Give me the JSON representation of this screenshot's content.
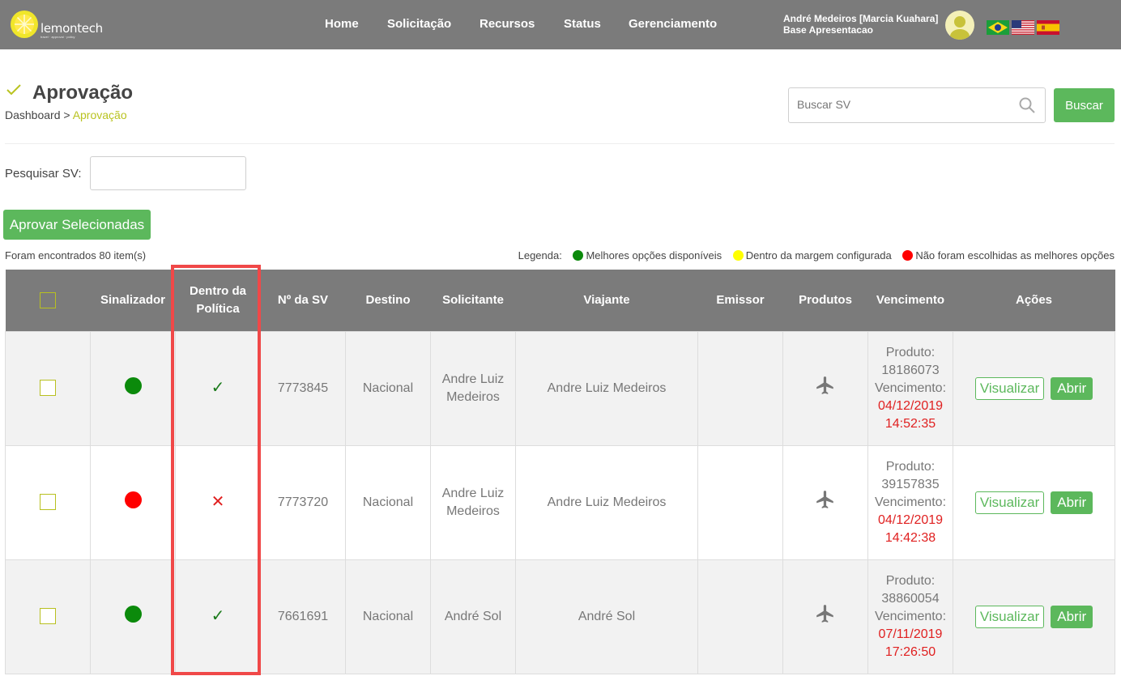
{
  "header": {
    "logo_text": "lemontech",
    "logo_tagline": "travel · approval · policy",
    "nav": [
      "Home",
      "Solicitação",
      "Recursos",
      "Status",
      "Gerenciamento"
    ],
    "user_line1": "André Medeiros [Marcia Kuahara]",
    "user_line2": "Base Apresentacao",
    "flags": [
      "flag-brazil",
      "flag-usa",
      "flag-spain"
    ]
  },
  "page": {
    "title": "Aprovação",
    "breadcrumb_root": "Dashboard",
    "breadcrumb_sep": " > ",
    "breadcrumb_current": "Aprovação",
    "search_placeholder": "Buscar SV",
    "search_button": "Buscar",
    "filter_label": "Pesquisar SV:",
    "approve_button": "Aprovar Selecionadas",
    "found_text": "Foram encontrados 80 item(s)",
    "legend_label": "Legenda:",
    "legend": [
      {
        "label": "Melhores opções disponíveis",
        "color": "#0b8a0b"
      },
      {
        "label": "Dentro da margem configurada",
        "color": "#ffff00"
      },
      {
        "label": "Não foram escolhidas as melhores opções",
        "color": "#ff0000"
      }
    ]
  },
  "table": {
    "columns": [
      "Sinalizador",
      "Dentro da Política",
      "Nº da SV",
      "Destino",
      "Solicitante",
      "Viajante",
      "Emissor",
      "Produtos",
      "Vencimento",
      "Ações"
    ],
    "colors": {
      "green": "#0b8a0b",
      "red": "#ff0000",
      "check": "#1a7a1a",
      "cross": "#e02020"
    },
    "view_label": "Visualizar",
    "open_label": "Abrir",
    "produto_label": "Produto:",
    "vencimento_label": "Vencimento:",
    "rows": [
      {
        "signal": "green",
        "policy": "✓",
        "sv": "7773845",
        "destino": "Nacional",
        "solicitante": "Andre Luiz Medeiros",
        "viajante": "Andre Luiz Medeiros",
        "emissor": "",
        "produto_icon": "airplane-icon",
        "produto_num": "18186073",
        "venc_date": "04/12/2019",
        "venc_time": "14:52:35"
      },
      {
        "signal": "red",
        "policy": "✕",
        "sv": "7773720",
        "destino": "Nacional",
        "solicitante": "Andre Luiz Medeiros",
        "viajante": "Andre Luiz Medeiros",
        "emissor": "",
        "produto_icon": "airplane-icon",
        "produto_num": "39157835",
        "venc_date": "04/12/2019",
        "venc_time": "14:42:38"
      },
      {
        "signal": "green",
        "policy": "✓",
        "sv": "7661691",
        "destino": "Nacional",
        "solicitante": "André Sol",
        "viajante": "André Sol",
        "emissor": "",
        "produto_icon": "airplane-icon",
        "produto_num": "38860054",
        "venc_date": "07/11/2019",
        "venc_time": "17:26:50"
      }
    ]
  }
}
